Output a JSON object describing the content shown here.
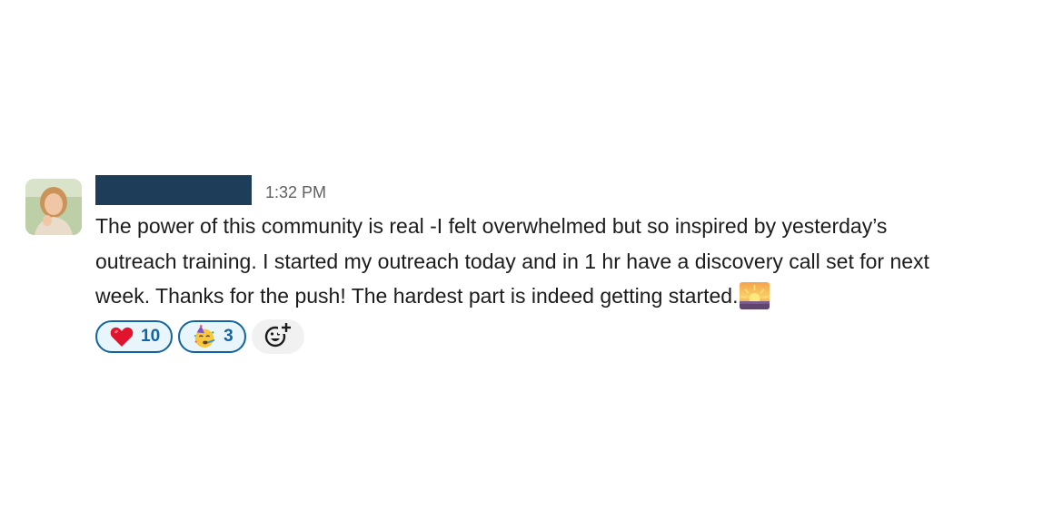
{
  "message": {
    "author_name": "",
    "timestamp": "1:32 PM",
    "body_lines": [
      "The power of this community is real -I felt overwhelmed but so inspired by yesterday’s",
      "outreach training.  I started my outreach today and in 1 hr have a discovery call set for next",
      "week.  Thanks for the push!  The hardest part is indeed getting started."
    ],
    "inline_emoji": "sunrise-emoji"
  },
  "reactions": [
    {
      "emoji": "heart-emoji",
      "count": "10"
    },
    {
      "emoji": "partying-face-emoji",
      "count": "3"
    }
  ],
  "add_reaction_icon": "add-reaction-icon",
  "colors": {
    "reaction_border": "#1264a3",
    "reaction_bg": "#e8f5fa",
    "redaction": "#1e3d58",
    "timestamp": "#616061"
  }
}
